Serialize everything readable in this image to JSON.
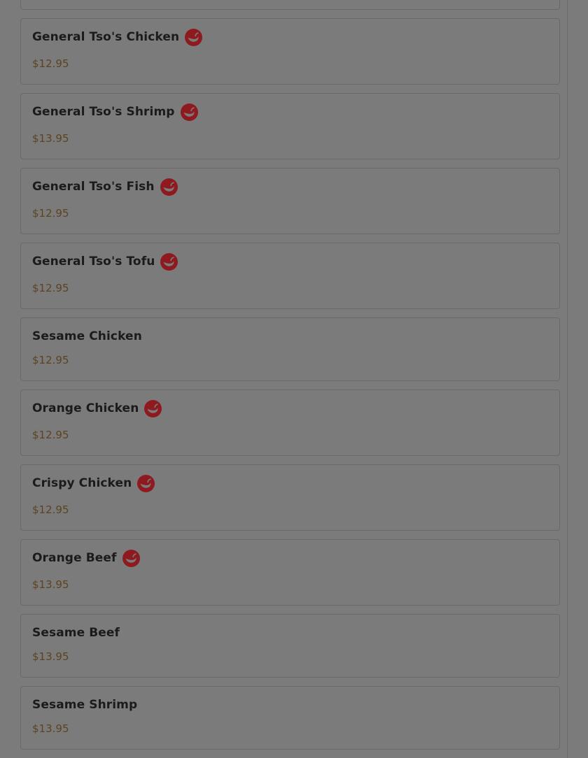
{
  "menu": {
    "items": [
      {
        "name": "General Tso's Chicken",
        "price": "$12.95",
        "spicy": true
      },
      {
        "name": "General Tso's Shrimp",
        "price": "$13.95",
        "spicy": true
      },
      {
        "name": "General Tso's Fish",
        "price": "$12.95",
        "spicy": true
      },
      {
        "name": "General Tso's Tofu",
        "price": "$12.95",
        "spicy": true
      },
      {
        "name": "Sesame Chicken",
        "price": "$12.95",
        "spicy": false
      },
      {
        "name": "Orange Chicken",
        "price": "$12.95",
        "spicy": true
      },
      {
        "name": "Crispy Chicken",
        "price": "$12.95",
        "spicy": true
      },
      {
        "name": "Orange Beef",
        "price": "$13.95",
        "spicy": true
      },
      {
        "name": "Sesame Beef",
        "price": "$13.95",
        "spicy": false
      },
      {
        "name": "Sesame Shrimp",
        "price": "$13.95",
        "spicy": false
      }
    ]
  },
  "icons": {
    "spicy": "chili-pepper-icon"
  },
  "colors": {
    "overlay_background": "#7b7b7b",
    "spicy_icon": "#8e1a1f",
    "price_text": "#5d4320",
    "name_text": "#1b1b1b"
  }
}
